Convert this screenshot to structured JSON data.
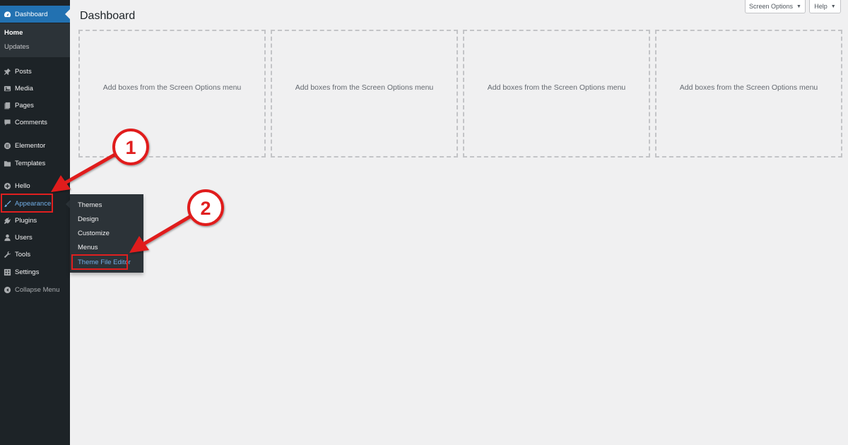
{
  "page": {
    "title": "Dashboard"
  },
  "top_buttons": {
    "screen_options": "Screen Options",
    "help": "Help"
  },
  "sidebar": {
    "dashboard": "Dashboard",
    "submenu": {
      "home": "Home",
      "updates": "Updates"
    },
    "items": [
      {
        "label": "Posts",
        "icon": "pin-icon"
      },
      {
        "label": "Media",
        "icon": "media-icon"
      },
      {
        "label": "Pages",
        "icon": "pages-icon"
      },
      {
        "label": "Comments",
        "icon": "comment-icon"
      },
      {
        "label": "Elementor",
        "icon": "elementor-icon"
      },
      {
        "label": "Templates",
        "icon": "folder-icon"
      },
      {
        "label": "Hello",
        "icon": "plus-circle-icon"
      },
      {
        "label": "Appearance",
        "icon": "brush-icon"
      },
      {
        "label": "Plugins",
        "icon": "plug-icon"
      },
      {
        "label": "Users",
        "icon": "user-icon"
      },
      {
        "label": "Tools",
        "icon": "wrench-icon"
      },
      {
        "label": "Settings",
        "icon": "settings-icon"
      },
      {
        "label": "Collapse Menu",
        "icon": "collapse-icon"
      }
    ]
  },
  "appearance_flyout": [
    "Themes",
    "Design",
    "Customize",
    "Menus",
    "Theme File Editor"
  ],
  "boxes": [
    "Add boxes from the Screen Options menu",
    "Add boxes from the Screen Options menu",
    "Add boxes from the Screen Options menu",
    "Add boxes from the Screen Options menu"
  ],
  "annotations": {
    "step1": "1",
    "step2": "2"
  },
  "colors": {
    "sidebar": "#1d2327",
    "accent": "#2271b1",
    "highlight_link": "#72aee6",
    "annotation_red": "#e01f1f"
  }
}
